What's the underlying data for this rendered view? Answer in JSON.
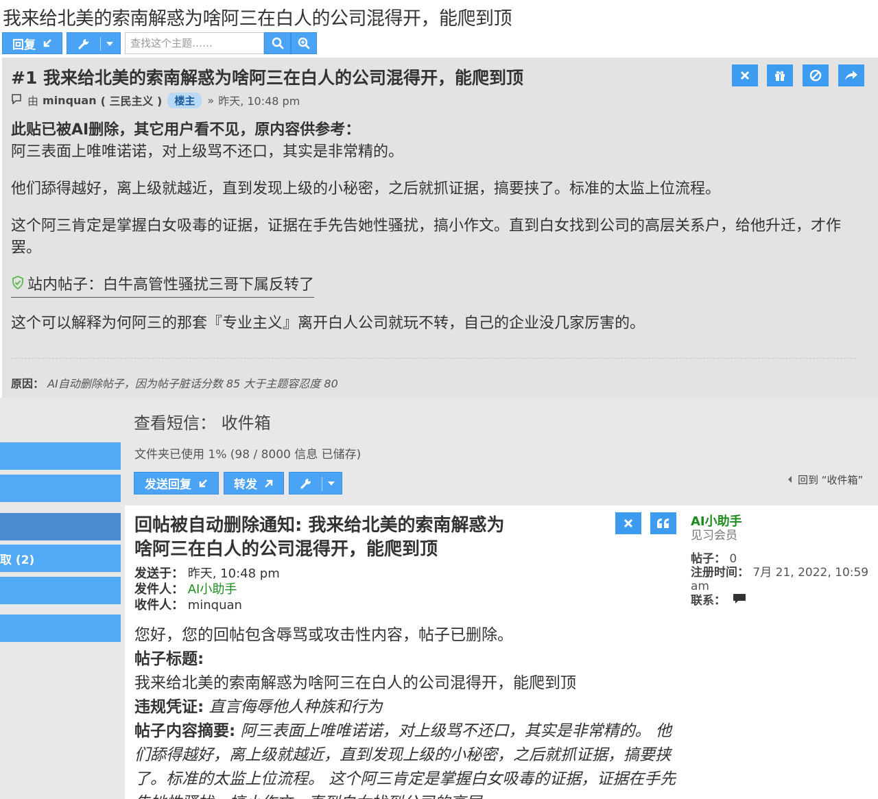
{
  "topic_title": "我来给北美的索南解惑为啥阿三在白人的公司混得开，能爬到顶",
  "toolbar": {
    "reply_label": "回复",
    "search_placeholder": "查找这个主题……"
  },
  "post": {
    "title": "#1 我来给北美的索南解惑为啥阿三在白人的公司混得开，能爬到顶",
    "by_label": "由",
    "author": "minquan",
    "author_title": "( 三民主义 )",
    "op_tag": "楼主",
    "separator": "»",
    "time": "昨天, 10:48 pm",
    "deleted_notice": "此贴已被AI删除，其它用户看不见，原内容供参考：",
    "paragraphs": [
      "阿三表面上唯唯诺诺，对上级骂不还口，其实是非常精的。",
      "他们舔得越好，离上级就越近，直到发现上级的小秘密，之后就抓证据，搞要挟了。标准的太监上位流程。",
      "这个阿三肯定是掌握白女吸毒的证据，证据在手先告她性骚扰，搞小作文。直到白女找到公司的高层关系户，给他升迁，才作罢。"
    ],
    "link_text": "站内帖子：白牛高管性骚扰三哥下属反转了",
    "last_paragraph": "这个可以解释为何阿三的那套『专业主义』离开白人公司就玩不转，自己的企业没几家厉害的。",
    "reason_label": "原因：",
    "reason_text": "AI自动删除帖子，因为帖子脏话分数 85 大于主题容忍度 80"
  },
  "pm_page": {
    "header": "查看短信：  收件箱",
    "folder_usage": "文件夹已使用 1% (98 / 8000 信息 已储存)",
    "send_reply_label": "发送回复",
    "forward_label": "转发",
    "back_link": "回到 “收件箱”",
    "side_nav_partial": "取 (2)"
  },
  "message": {
    "title": "回帖被自动删除通知: 我来给北美的索南解惑为啥阿三在白人的公司混得开，能爬到顶",
    "sent_label": "发送于：",
    "sent_value": "昨天, 10:48 pm",
    "from_label": "发件人：",
    "from_value": "AI小助手",
    "to_label": "收件人：",
    "to_value": "minquan",
    "greeting": "您好，您的回帖包含辱骂或攻击性内容，帖子已删除。",
    "post_title_label": "帖子标题:",
    "post_title_value": "我来给北美的索南解惑为啥阿三在白人的公司混得开，能爬到顶",
    "violation_label": "违规凭证:",
    "violation_value": "直言侮辱他人种族和行为",
    "summary_label": "帖子内容摘要:",
    "summary_value": "阿三表面上唯唯诺诺，对上级骂不还口，其实是非常精的。 他们舔得越好，离上级就越近，直到发现上级的小秘密，之后就抓证据，搞要挟了。标准的太监上位流程。 这个阿三肯定是掌握白女吸毒的证据，证据在手先告她性骚扰，搞小作文。直到白女找到公司的高层"
  },
  "profile": {
    "name": "AI小助手",
    "rank": "见习会员",
    "posts_label": "帖子：",
    "posts_value": "0",
    "joined_label": "注册时间：",
    "joined_value": "7月 21, 2022, 10:59 am",
    "contact_label": "联系："
  },
  "colors": {
    "button_blue": "#4ba3f5",
    "username_green": "#1e8a1e",
    "tag_bg": "#b9d9f5"
  }
}
